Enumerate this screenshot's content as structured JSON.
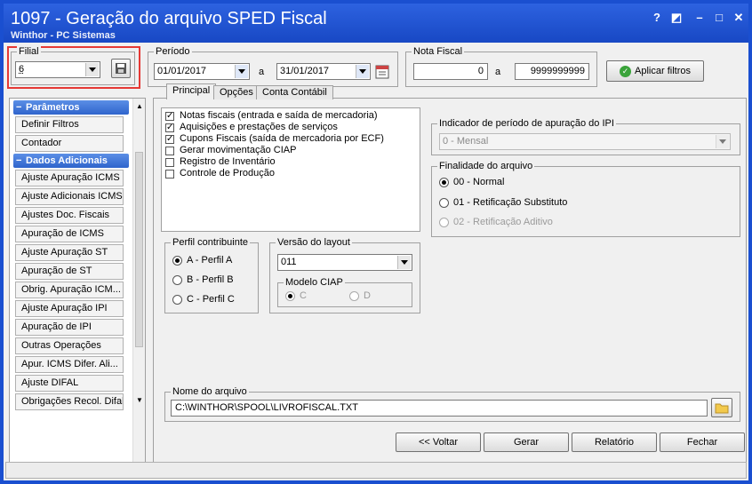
{
  "window": {
    "title": "1097 - Geração do arquivo SPED Fiscal",
    "subtitle": "Winthor - PC Sistemas"
  },
  "filial": {
    "legend": "Filial",
    "value": "6"
  },
  "periodo": {
    "legend": "Período",
    "start": "01/01/2017",
    "sep": "a",
    "end": "31/01/2017"
  },
  "nota_fiscal": {
    "legend": "Nota Fiscal",
    "start": "0",
    "sep": "a",
    "end": "9999999999"
  },
  "apply_button": "Aplicar filtros",
  "sidebar": {
    "section1": "Parâmetros",
    "items1": [
      "Definir Filtros",
      "Contador"
    ],
    "section2": "Dados Adicionais",
    "items2": [
      "Ajuste Apuração ICMS",
      "Ajuste Adicionais ICMS",
      "Ajustes Doc. Fiscais",
      "Apuração de ICMS",
      "Ajuste Apuração ST",
      "Apuração de ST",
      "Obrig. Apuração ICM...",
      "Ajuste Apuração IPI",
      "Apuração de IPI",
      "Outras Operações",
      "Apur. ICMS Difer. Ali...",
      "Ajuste DIFAL",
      "Obrigações Recol. Difal"
    ]
  },
  "tabs": [
    "Principal",
    "Opções",
    "Conta Contábil"
  ],
  "checklist": [
    {
      "label": "Notas fiscais (entrada e saída de mercadoria)",
      "checked": true
    },
    {
      "label": "Aquisições e prestações de serviços",
      "checked": true
    },
    {
      "label": "Cupons Fiscais (saída de mercadoria por ECF)",
      "checked": true
    },
    {
      "label": "Gerar movimentação CIAP",
      "checked": false
    },
    {
      "label": "Registro de Inventário",
      "checked": false
    },
    {
      "label": "Controle de Produção",
      "checked": false
    }
  ],
  "ipi": {
    "legend": "Indicador de período de apuração do IPI",
    "value": "0 - Mensal"
  },
  "finalidade": {
    "legend": "Finalidade do arquivo",
    "options": [
      "00 - Normal",
      "01 - Retificação Substituto",
      "02 - Retificação Aditivo"
    ]
  },
  "perfil": {
    "legend": "Perfil contribuinte",
    "options": [
      "A - Perfil A",
      "B - Perfil B",
      "C - Perfil C"
    ]
  },
  "layout": {
    "legend": "Versão do layout",
    "value": "011"
  },
  "ciap": {
    "legend": "Modelo CIAP",
    "options": [
      "C",
      "D"
    ]
  },
  "arquivo": {
    "legend": "Nome do arquivo",
    "value": "C:\\WINTHOR\\SPOOL\\LIVROFISCAL.TXT"
  },
  "footer": {
    "voltar": "<< Voltar",
    "gerar": "Gerar",
    "relatorio": "Relatório",
    "fechar": "Fechar"
  },
  "colors": {
    "title_bar": "#1848c4",
    "highlight_box": "#e53935",
    "section_header": "#2f64cc"
  }
}
